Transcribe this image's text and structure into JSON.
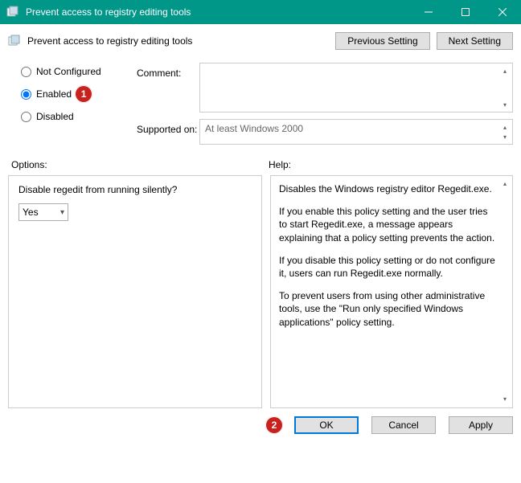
{
  "titlebar": {
    "title": "Prevent access to registry editing tools"
  },
  "header": {
    "title": "Prevent access to registry editing tools",
    "prev_btn": "Previous Setting",
    "next_btn": "Next Setting"
  },
  "radios": {
    "not_configured": "Not Configured",
    "enabled": "Enabled",
    "disabled": "Disabled",
    "selected": "enabled"
  },
  "labels": {
    "comment": "Comment:",
    "supported": "Supported on:",
    "options": "Options:",
    "help": "Help:"
  },
  "supported_text": "At least Windows 2000",
  "options": {
    "disable_silent_label": "Disable regedit from running silently?",
    "disable_silent_value": "Yes"
  },
  "help": {
    "p1": "Disables the Windows registry editor Regedit.exe.",
    "p2": "If you enable this policy setting and the user tries to start Regedit.exe, a message appears explaining that a policy setting prevents the action.",
    "p3": "If you disable this policy setting or do not configure it, users can run Regedit.exe normally.",
    "p4": "To prevent users from using other administrative tools, use the \"Run only specified Windows applications\" policy setting."
  },
  "footer": {
    "ok": "OK",
    "cancel": "Cancel",
    "apply": "Apply"
  },
  "annotations": {
    "step1": "1",
    "step2": "2"
  }
}
